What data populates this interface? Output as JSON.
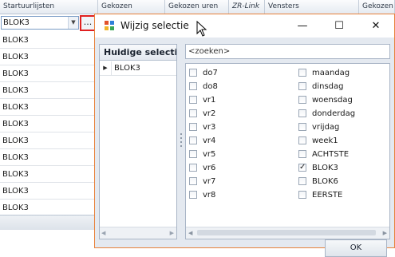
{
  "grid": {
    "headers": [
      "Startuurlijsten",
      "Gekozen",
      "Gekozen uren",
      "ZR-Link",
      "Vensters",
      "Gekozen"
    ],
    "editor_value": "BLOK3",
    "ellipsis_label": "...",
    "rows": [
      "BLOK3",
      "BLOK3",
      "BLOK3",
      "BLOK3",
      "BLOK3",
      "BLOK3",
      "BLOK3",
      "BLOK3",
      "BLOK3",
      "BLOK3",
      "BLOK3"
    ]
  },
  "dialog": {
    "title": "Wijzig selectie",
    "minimize_glyph": "—",
    "maximize_glyph": "☐",
    "close_glyph": "✕",
    "left_header": "Huidige selectie",
    "left_items": [
      {
        "label": "BLOK3",
        "marker": "▶"
      }
    ],
    "search_placeholder": "<zoeken>",
    "options_col1": [
      {
        "label": "do7",
        "checked": false
      },
      {
        "label": "do8",
        "checked": false
      },
      {
        "label": "vr1",
        "checked": false
      },
      {
        "label": "vr2",
        "checked": false
      },
      {
        "label": "vr3",
        "checked": false
      },
      {
        "label": "vr4",
        "checked": false
      },
      {
        "label": "vr5",
        "checked": false
      },
      {
        "label": "vr6",
        "checked": false
      },
      {
        "label": "vr7",
        "checked": false
      },
      {
        "label": "vr8",
        "checked": false
      }
    ],
    "options_col2": [
      {
        "label": "maandag",
        "checked": false
      },
      {
        "label": "dinsdag",
        "checked": false
      },
      {
        "label": "woensdag",
        "checked": false
      },
      {
        "label": "donderdag",
        "checked": false
      },
      {
        "label": "vrijdag",
        "checked": false
      },
      {
        "label": "week1",
        "checked": false
      },
      {
        "label": "ACHTSTE",
        "checked": false
      },
      {
        "label": "BLOK3",
        "checked": true
      },
      {
        "label": "BLOK6",
        "checked": false
      },
      {
        "label": "EERSTE",
        "checked": false
      }
    ],
    "ok_label": "OK"
  },
  "colors": {
    "dialog_border": "#e8813a",
    "ellipsis_highlight": "#e02020",
    "client_background": "#e4e9f0"
  }
}
